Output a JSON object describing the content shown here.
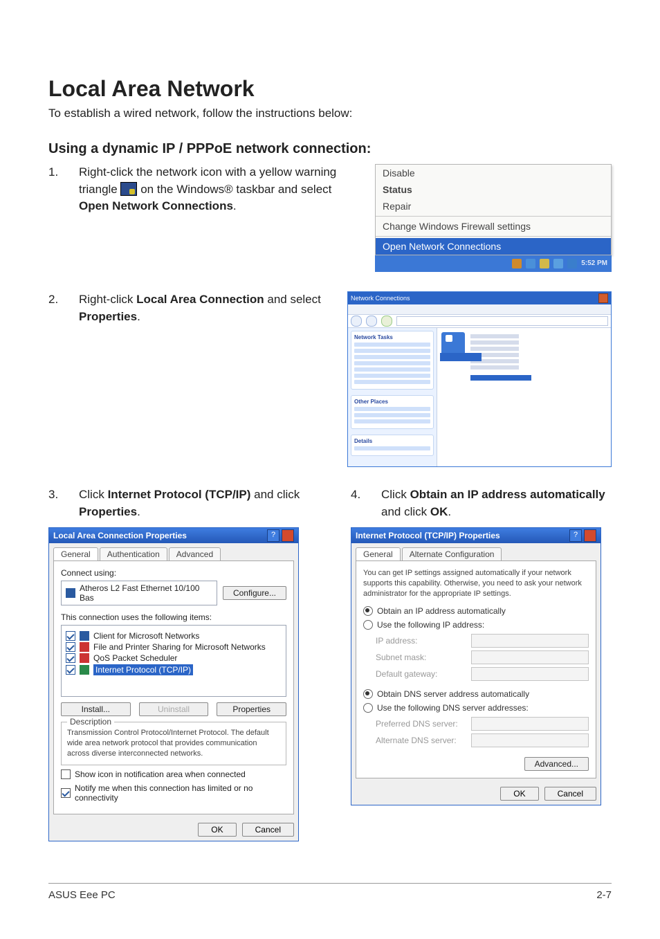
{
  "page": {
    "title": "Local Area Network",
    "intro": "To establish a wired network, follow the instructions below:",
    "subtitle": "Using a dynamic IP / PPPoE network connection:"
  },
  "steps": {
    "s1": {
      "num": "1.",
      "text_a": "Right-click the network icon with a yellow warning triangle ",
      "text_b": " on the Windows® taskbar and select ",
      "bold": "Open Network Connections",
      "tail": "."
    },
    "s2": {
      "num": "2.",
      "text_a": "Right-click ",
      "bold1": "Local Area Connection",
      "mid": " and select ",
      "bold2": "Properties",
      "tail": "."
    },
    "s3": {
      "num": "3.",
      "text_a": "Click ",
      "bold1": "Internet Protocol (TCP/IP)",
      "mid": " and click ",
      "bold2": "Properties",
      "tail": "."
    },
    "s4": {
      "num": "4.",
      "text_a": "Click ",
      "bold1": "Obtain an IP address automatically",
      "mid": " and click ",
      "bold2": "OK",
      "tail": "."
    }
  },
  "ctxmenu": {
    "disable": "Disable",
    "status": "Status",
    "repair": "Repair",
    "firewall": "Change Windows Firewall settings",
    "open": "Open Network Connections",
    "time": "5:52 PM"
  },
  "explorer": {
    "title": "Network Connections",
    "task_hd": "Network Tasks",
    "other_hd": "Other Places",
    "details_hd": "Details",
    "lan": "Local Area Connection"
  },
  "lacDlg": {
    "title": "Local Area Connection Properties",
    "tabs": {
      "general": "General",
      "auth": "Authentication",
      "adv": "Advanced"
    },
    "connect_using": "Connect using:",
    "adapter": "Atheros L2 Fast Ethernet 10/100 Bas",
    "configure": "Configure...",
    "uses": "This connection uses the following items:",
    "items": {
      "client": "Client for Microsoft Networks",
      "fps": "File and Printer Sharing for Microsoft Networks",
      "qos": "QoS Packet Scheduler",
      "tcpip": "Internet Protocol (TCP/IP)"
    },
    "install": "Install...",
    "uninstall": "Uninstall",
    "properties": "Properties",
    "desc_hd": "Description",
    "desc": "Transmission Control Protocol/Internet Protocol. The default wide area network protocol that provides communication across diverse interconnected networks.",
    "show_icon": "Show icon in notification area when connected",
    "notify": "Notify me when this connection has limited or no connectivity",
    "ok": "OK",
    "cancel": "Cancel"
  },
  "ipDlg": {
    "title": "Internet Protocol (TCP/IP) Properties",
    "tabs": {
      "general": "General",
      "alt": "Alternate Configuration"
    },
    "blurb": "You can get IP settings assigned automatically if your network supports this capability. Otherwise, you need to ask your network administrator for the appropriate IP settings.",
    "obtain_ip": "Obtain an IP address automatically",
    "use_ip": "Use the following IP address:",
    "ip_lbl": "IP address:",
    "subnet_lbl": "Subnet mask:",
    "gw_lbl": "Default gateway:",
    "obtain_dns": "Obtain DNS server address automatically",
    "use_dns": "Use the following DNS server addresses:",
    "pref_dns": "Preferred DNS server:",
    "alt_dns": "Alternate DNS server:",
    "advanced": "Advanced...",
    "ok": "OK",
    "cancel": "Cancel"
  },
  "footer": {
    "left": "ASUS Eee PC",
    "right": "2-7"
  }
}
